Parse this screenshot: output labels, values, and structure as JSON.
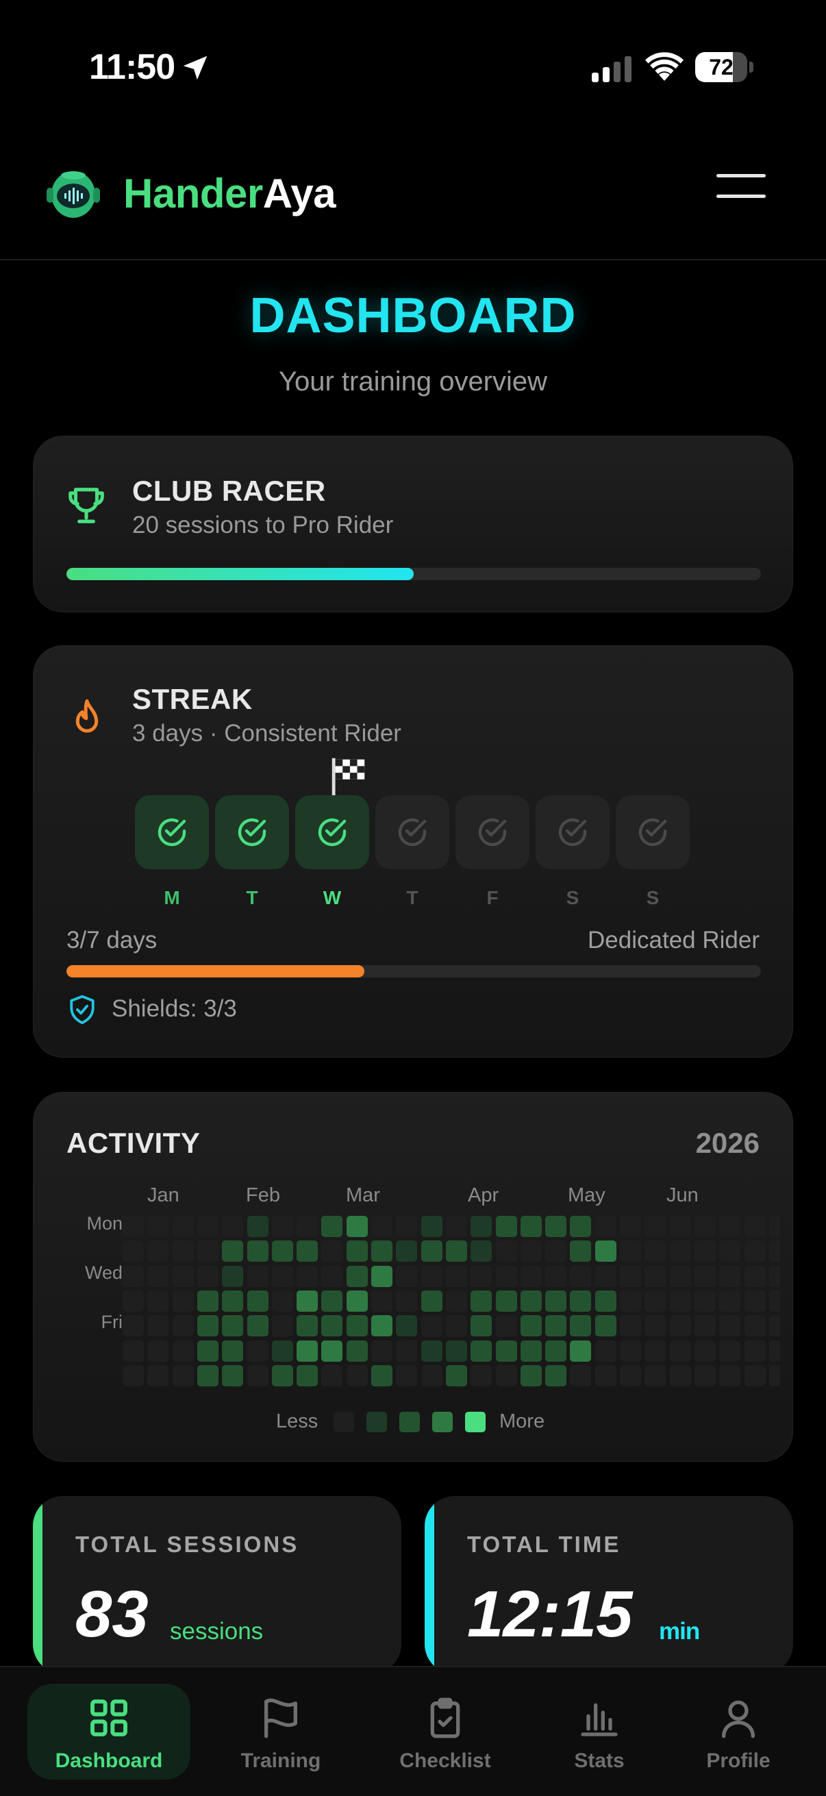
{
  "status_bar": {
    "time": "11:50",
    "battery": "72",
    "battery_level": 0.72
  },
  "header": {
    "brand_green": "Hander",
    "brand_white": "Aya"
  },
  "page": {
    "title": "DASHBOARD",
    "subtitle": "Your training overview"
  },
  "rank": {
    "title": "CLUB RACER",
    "subtitle": "20 sessions to Pro Rider",
    "progress": 0.5
  },
  "streak": {
    "title": "STREAK",
    "subtitle": "3 days · Consistent Rider",
    "days": [
      {
        "label": "M",
        "done": true
      },
      {
        "label": "T",
        "done": true
      },
      {
        "label": "W",
        "done": true,
        "today": true
      },
      {
        "label": "T",
        "done": false
      },
      {
        "label": "F",
        "done": false
      },
      {
        "label": "S",
        "done": false
      },
      {
        "label": "S",
        "done": false
      }
    ],
    "count_text": "3/7 days",
    "goal_text": "Dedicated Rider",
    "progress": 0.4286,
    "shields_text": "Shields: 3/3"
  },
  "activity": {
    "title": "ACTIVITY",
    "year": "2026",
    "months": [
      "Jan",
      "Feb",
      "Mar",
      "Apr",
      "May",
      "Jun"
    ],
    "weekday_labels": [
      "Mon",
      "Wed",
      "Fri"
    ],
    "legend_less": "Less",
    "legend_more": "More",
    "levels": [
      "0000010023001012222000000000",
      "0000222202212210002300000000",
      "0000100002300000000000000000",
      "0002220323002022222200000000",
      "0002220222310020222200000000",
      "0002201332001122223000000000",
      "0002202200200200220000000000"
    ]
  },
  "stats": [
    {
      "label": "TOTAL SESSIONS",
      "value": "83",
      "unit": "sessions"
    },
    {
      "label": "TOTAL TIME",
      "value": "12:15",
      "unit": "min"
    }
  ],
  "nav": [
    {
      "label": "Dashboard",
      "icon": "dashboard-icon",
      "active": true
    },
    {
      "label": "Training",
      "icon": "flag-icon"
    },
    {
      "label": "Checklist",
      "icon": "clipboard-check-icon"
    },
    {
      "label": "Stats",
      "icon": "bar-chart-icon"
    },
    {
      "label": "Profile",
      "icon": "user-icon"
    }
  ],
  "colors": {
    "green": "#4ade80",
    "cyan": "#22e5f0",
    "orange": "#f5832a",
    "activity_levels": [
      "#1f1f1f",
      "#1e3b27",
      "#24542f",
      "#2f7a42",
      "#4ade80"
    ]
  }
}
